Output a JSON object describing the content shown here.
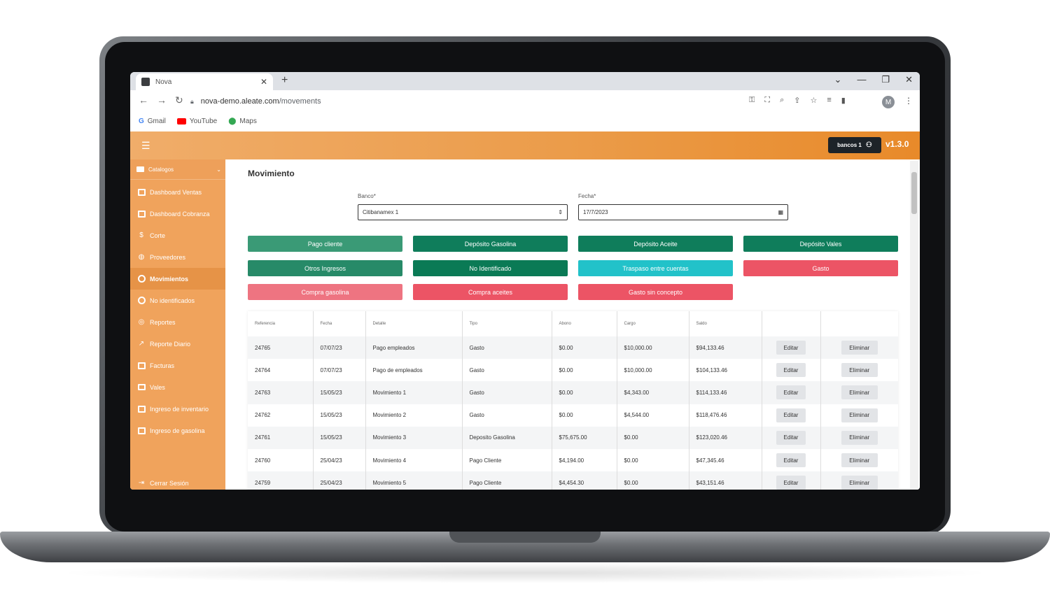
{
  "browser": {
    "tab_title": "Nova",
    "url_host": "nova-demo.aleate.com",
    "url_path": "/movements",
    "bookmarks": [
      "Gmail",
      "YouTube",
      "Maps"
    ],
    "profile_initial": "M"
  },
  "header": {
    "user": "bancos 1",
    "version": "v1.3.0"
  },
  "sidebar": {
    "section": "Catalogos",
    "items": [
      {
        "label": "Dashboard Ventas",
        "icon": "dashboard-icon"
      },
      {
        "label": "Dashboard Cobranza",
        "icon": "dashboard-icon"
      },
      {
        "label": "Corte",
        "icon": "dollar-icon"
      },
      {
        "label": "Proveedores",
        "icon": "globe-icon"
      },
      {
        "label": "Movimientos",
        "icon": "target-icon",
        "active": true
      },
      {
        "label": "No identificados",
        "icon": "target-icon"
      },
      {
        "label": "Reportes",
        "icon": "reports-icon"
      },
      {
        "label": "Reporte Diario",
        "icon": "trend-icon"
      },
      {
        "label": "Facturas",
        "icon": "monitor-icon"
      },
      {
        "label": "Vales",
        "icon": "card-icon"
      },
      {
        "label": "Ingreso de inventario",
        "icon": "list-icon"
      },
      {
        "label": "Ingreso de gasolina",
        "icon": "list-icon"
      }
    ],
    "logout": "Cerrar Sesión"
  },
  "main": {
    "title": "Movimiento",
    "banco_label": "Banco",
    "banco_value": "Citibanamex 1",
    "fecha_label": "Fecha",
    "fecha_value": "17/7/2023",
    "buttons": [
      {
        "label": "Pago cliente",
        "color": "#3a9a76"
      },
      {
        "label": "Depósito Gasolina",
        "color": "#0f7d5b"
      },
      {
        "label": "Depósito Aceite",
        "color": "#0f7d5b"
      },
      {
        "label": "Depósito Vales",
        "color": "#0f7d5b"
      },
      {
        "label": "Otros Ingresos",
        "color": "#278a68"
      },
      {
        "label": "No Identificado",
        "color": "#0a7a55"
      },
      {
        "label": "Traspaso entre cuentas",
        "color": "#22c2c9"
      },
      {
        "label": "Gasto",
        "color": "#ec5465"
      },
      {
        "label": "Compra gasolina",
        "color": "#ee7481"
      },
      {
        "label": "Compra aceites",
        "color": "#ec5465"
      },
      {
        "label": "Gasto sin concepto",
        "color": "#ec5465"
      }
    ]
  },
  "table": {
    "headers": [
      "Referencia",
      "Fecha",
      "Detalle",
      "Tipo",
      "Abono",
      "Cargo",
      "Saldo",
      "",
      ""
    ],
    "edit_label": "Editar",
    "delete_label": "Eliminar",
    "rows": [
      [
        "24765",
        "07/07/23",
        "Pago empleados",
        "Gasto",
        "$0.00",
        "$10,000.00",
        "$94,133.46"
      ],
      [
        "24764",
        "07/07/23",
        "Pago de empleados",
        "Gasto",
        "$0.00",
        "$10,000.00",
        "$104,133.46"
      ],
      [
        "24763",
        "15/05/23",
        "Movimiento 1",
        "Gasto",
        "$0.00",
        "$4,343.00",
        "$114,133.46"
      ],
      [
        "24762",
        "15/05/23",
        "Movimiento 2",
        "Gasto",
        "$0.00",
        "$4,544.00",
        "$118,476.46"
      ],
      [
        "24761",
        "15/05/23",
        "Movimiento 3",
        "Deposito Gasolina",
        "$75,675.00",
        "$0.00",
        "$123,020.46"
      ],
      [
        "24760",
        "25/04/23",
        "Movimiento 4",
        "Pago Cliente",
        "$4,194.00",
        "$0.00",
        "$47,345.46"
      ],
      [
        "24759",
        "25/04/23",
        "Movimiento 5",
        "Pago Cliente",
        "$4,454.30",
        "$0.00",
        "$43,151.46"
      ]
    ]
  }
}
